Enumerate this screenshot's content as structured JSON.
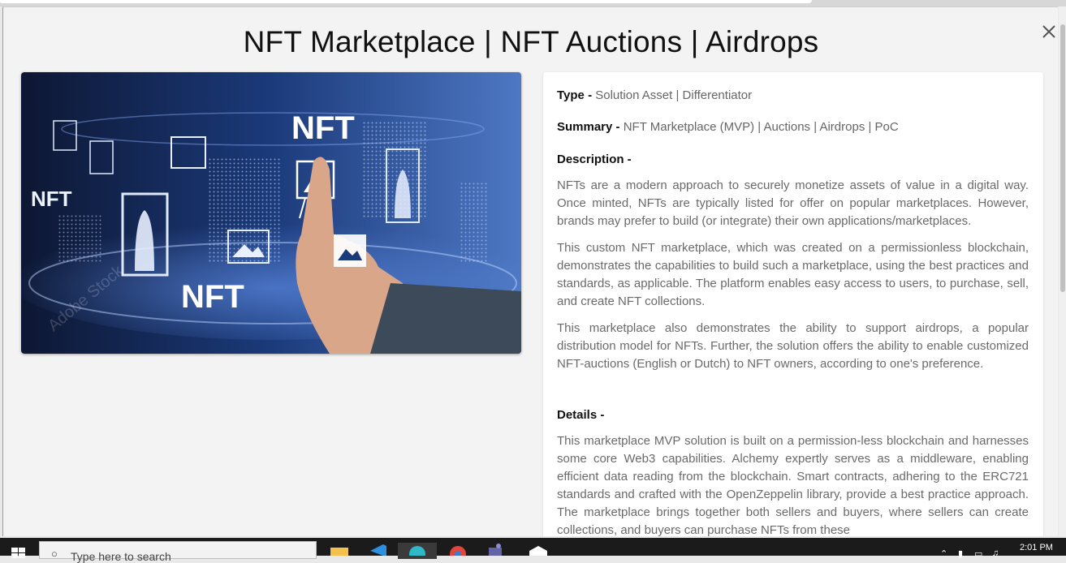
{
  "modal": {
    "title": "NFT Marketplace | NFT Auctions | Airdrops",
    "close_icon": "close-icon"
  },
  "hero": {
    "alt": "NFT marketplace concept image",
    "nft_text_top": "NFT",
    "nft_text_bottom": "NFT",
    "nft_text_left": "NFT",
    "watermark": "Adobe Stock"
  },
  "details": {
    "type_label": "Type -",
    "type_value": "Solution Asset | Differentiator",
    "summary_label": "Summary -",
    "summary_value": "NFT Marketplace (MVP) | Auctions | Airdrops | PoC",
    "description_heading": "Description -",
    "description_paragraphs": [
      "NFTs are a modern approach to securely monetize assets of value in a digital way. Once minted, NFTs are typically listed for offer on popular marketplaces. However, brands may prefer to build (or integrate) their own applications/marketplaces.",
      "This custom NFT marketplace, which was created on a permissionless blockchain, demonstrates the capabilities to build such a marketplace, using the best practices and standards, as applicable. The platform enables easy access to users, to purchase, sell, and create NFT collections.",
      "This marketplace also demonstrates the ability to support airdrops, a popular distribution model for NFTs. Further, the solution offers the ability to enable customized NFT-auctions (English or Dutch) to NFT owners, according to one's preference."
    ],
    "details_heading": "Details -",
    "details_paragraph": "This marketplace MVP solution is built on a permission-less blockchain and harnesses some core Web3 capabilities. Alchemy expertly serves as a middleware, enabling efficient data reading from the blockchain. Smart contracts, adhering to the ERC721 standards and crafted with the OpenZeppelin library, provide a best practice approach. The marketplace brings together both sellers and buyers, where sellers can create collections, and buyers can purchase NFTs from these"
  },
  "taskbar": {
    "search_placeholder": "Type here to search",
    "time": "2:01 PM",
    "apps": [
      "file-explorer-icon",
      "vscode-icon",
      "edge-icon",
      "chrome-icon",
      "teams-icon",
      "mail-icon"
    ]
  },
  "colors": {
    "accent_dark": "#111111",
    "muted_text": "#6a6a6a",
    "card_bg": "#ffffff",
    "modal_bg": "#f3f3f3"
  }
}
